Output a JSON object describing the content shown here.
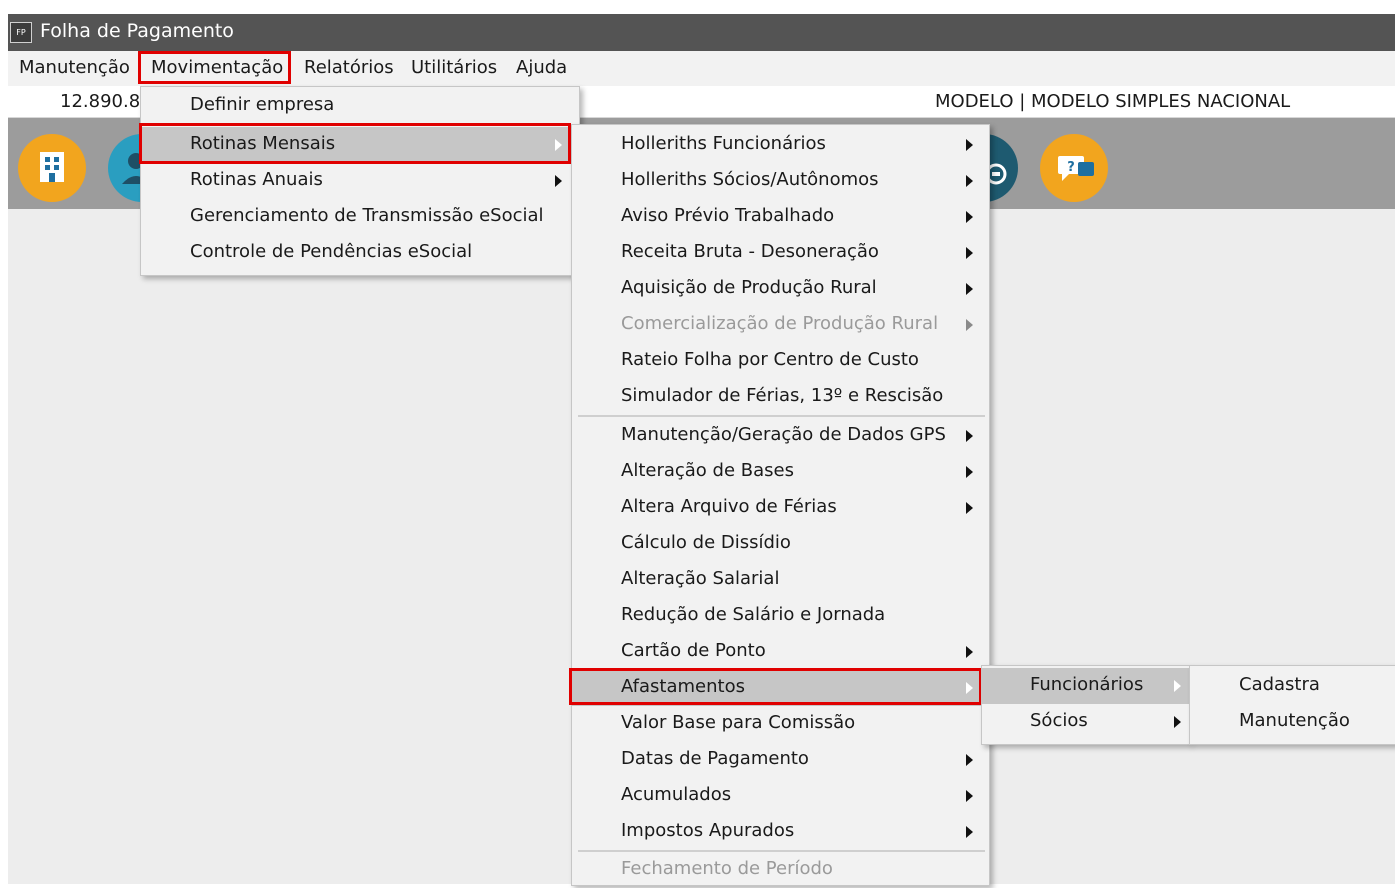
{
  "window": {
    "title": "Folha de Pagamento",
    "icon_label": "FP"
  },
  "menubar": {
    "items": [
      "Manutenção",
      "Movimentação",
      "Relatórios",
      "Utilitários",
      "Ajuda"
    ],
    "active": "Movimentação"
  },
  "infobar": {
    "left_text": "12.890.8",
    "right_text": "MODELO | MODELO SIMPLES NACIONAL"
  },
  "toolbar": {
    "icons": [
      {
        "name": "company-icon",
        "color": "#f2a51e"
      },
      {
        "name": "employee-icon",
        "color": "#1e8fb5"
      },
      {
        "name": "sync-icon",
        "color": "#1e5a70"
      },
      {
        "name": "help-chat-icon",
        "color": "#f2a51e"
      }
    ]
  },
  "menus": {
    "movimentacao": [
      {
        "label": "Definir empresa"
      },
      {
        "label": "Rotinas Mensais",
        "submenu": true,
        "highlighted": true
      },
      {
        "label": "Rotinas Anuais",
        "submenu": true
      },
      {
        "label": "Gerenciamento de Transmissão eSocial"
      },
      {
        "label": "Controle de Pendências eSocial"
      }
    ],
    "rotinas_mensais": [
      {
        "label": "Holleriths Funcionários",
        "submenu": true
      },
      {
        "label": "Holleriths Sócios/Autônomos",
        "submenu": true
      },
      {
        "label": "Aviso Prévio Trabalhado",
        "submenu": true
      },
      {
        "label": "Receita Bruta - Desoneração",
        "submenu": true
      },
      {
        "label": "Aquisição de Produção Rural",
        "submenu": true
      },
      {
        "label": "Comercialização de Produção Rural",
        "submenu": true,
        "disabled": true
      },
      {
        "label": "Rateio Folha por Centro de Custo"
      },
      {
        "label": "Simulador de Férias, 13º e Rescisão"
      },
      {
        "label": "Manutenção/Geração de Dados GPS",
        "submenu": true
      },
      {
        "label": "Alteração de Bases",
        "submenu": true
      },
      {
        "label": "Altera Arquivo de Férias",
        "submenu": true
      },
      {
        "label": "Cálculo de Dissídio"
      },
      {
        "label": "Alteração Salarial"
      },
      {
        "label": "Redução de Salário e Jornada"
      },
      {
        "label": "Cartão de Ponto",
        "submenu": true
      },
      {
        "label": "Afastamentos",
        "submenu": true,
        "highlighted": true
      },
      {
        "label": "Valor Base para Comissão"
      },
      {
        "label": "Datas de Pagamento",
        "submenu": true
      },
      {
        "label": "Acumulados",
        "submenu": true
      },
      {
        "label": "Impostos Apurados",
        "submenu": true
      },
      {
        "label": "Fechamento de Período",
        "disabled": true
      }
    ],
    "afastamentos": [
      {
        "label": "Funcionários",
        "submenu": true,
        "highlighted": true
      },
      {
        "label": "Sócios",
        "submenu": true
      }
    ],
    "funcionarios": [
      {
        "label": "Cadastra"
      },
      {
        "label": "Manutenção"
      }
    ]
  },
  "colors": {
    "highlight_box": "#e00000",
    "menu_bg": "#f2f2f2",
    "menu_highlight": "#c6c6c6",
    "titlebar": "#545454"
  }
}
